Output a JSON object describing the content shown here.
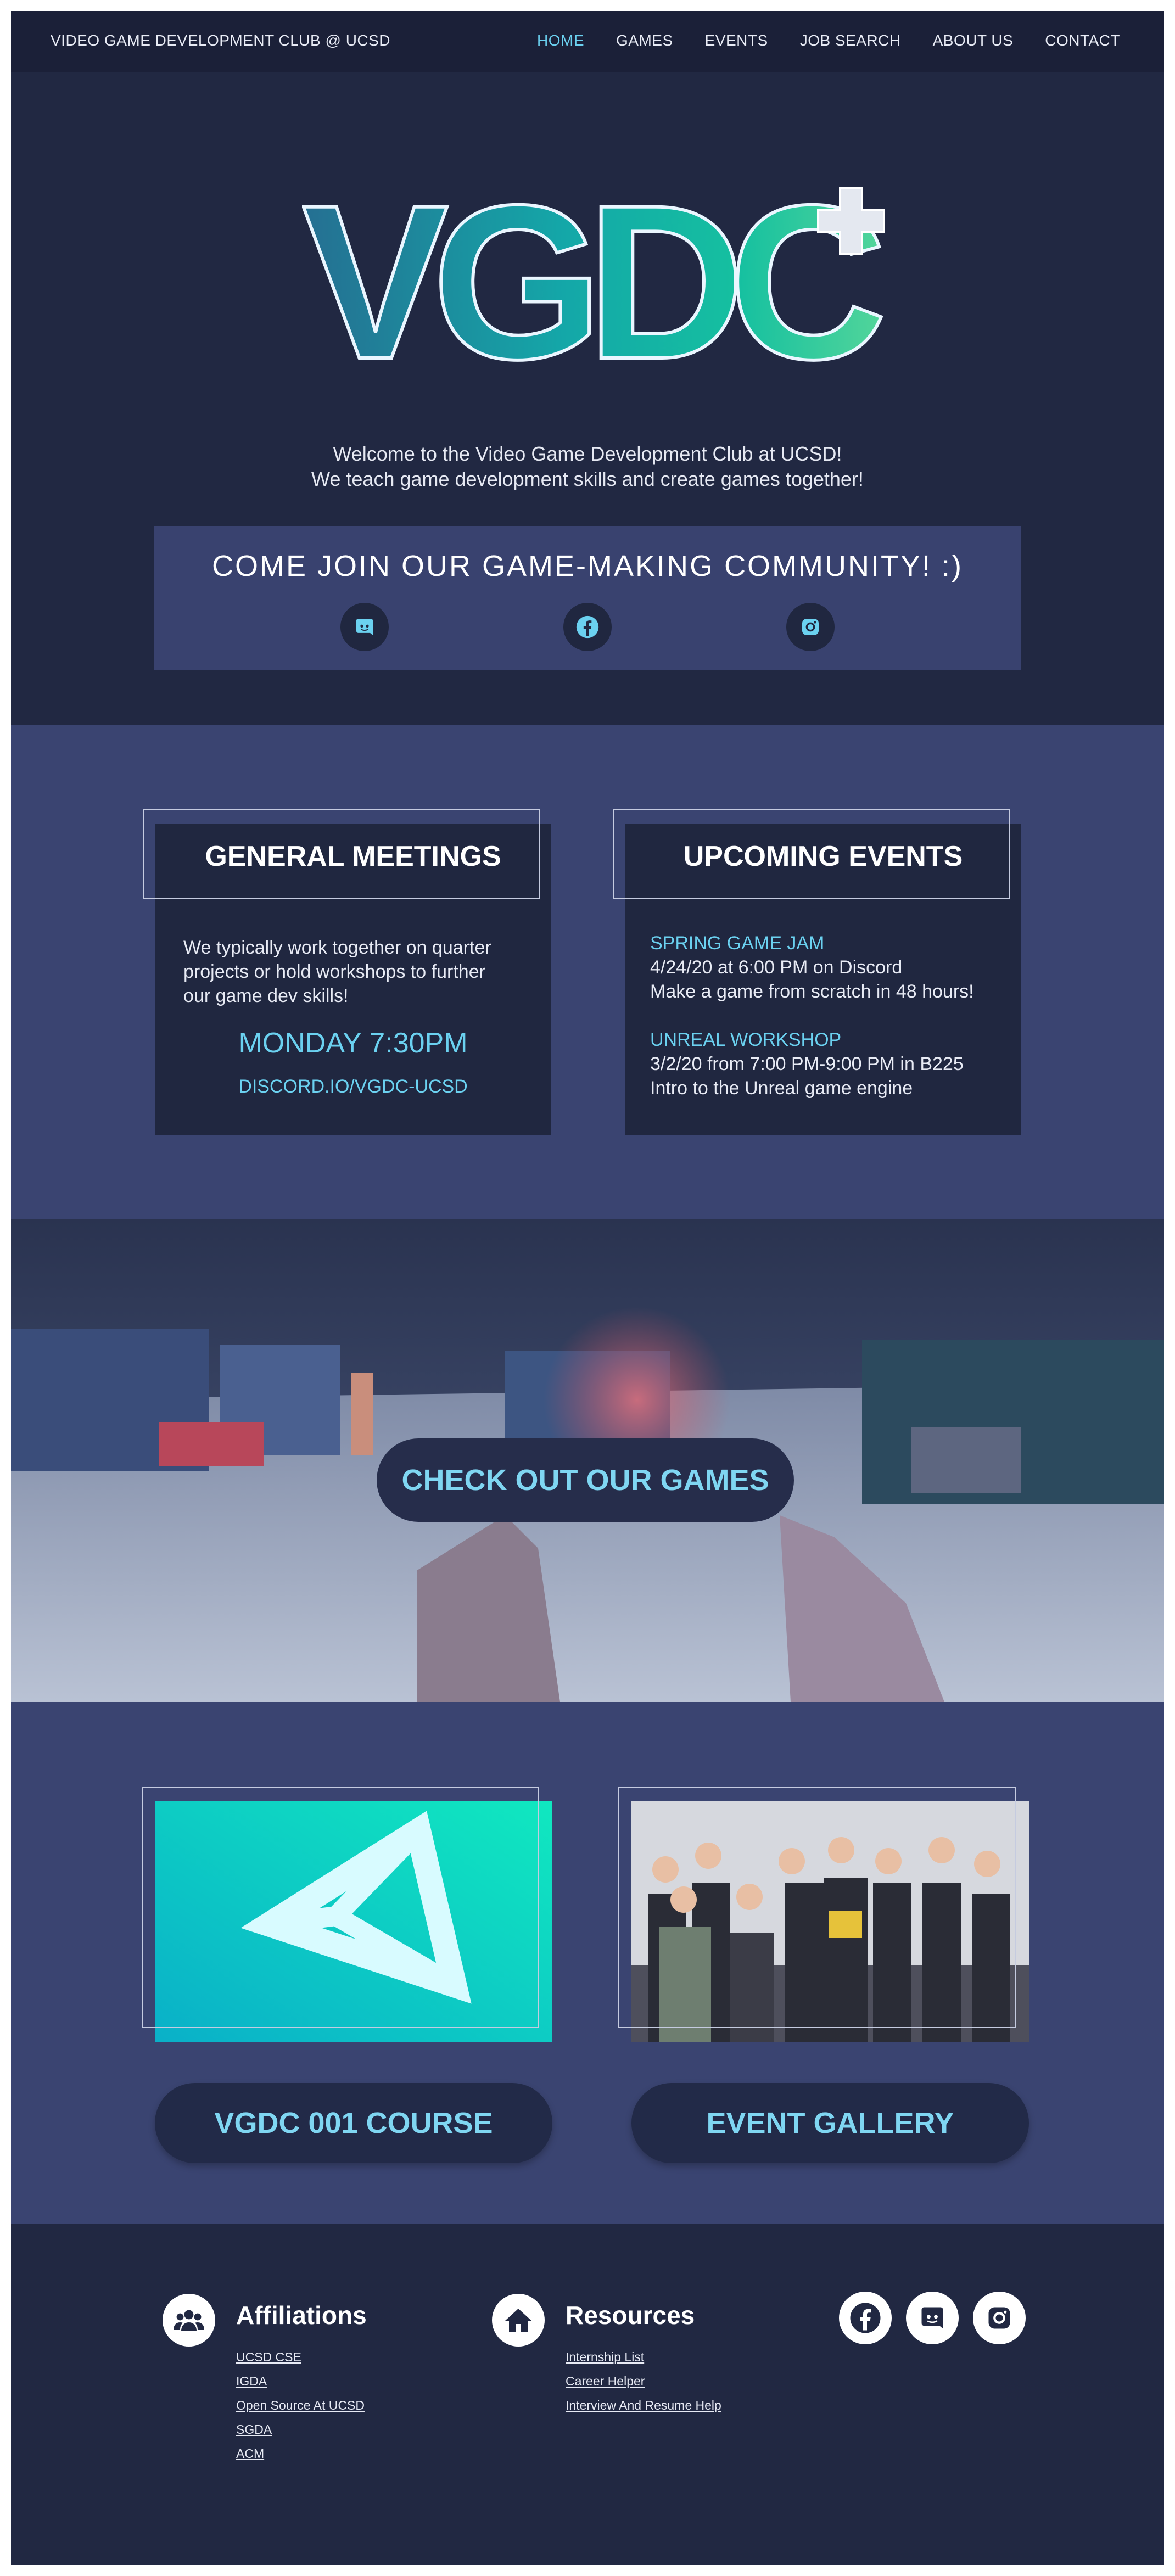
{
  "nav": {
    "brand": "VIDEO GAME DEVELOPMENT CLUB @ UCSD",
    "links": [
      "HOME",
      "GAMES",
      "EVENTS",
      "JOB SEARCH",
      "ABOUT US",
      "CONTACT"
    ],
    "active": "HOME"
  },
  "hero": {
    "logo_text": "VGDC",
    "welcome_line1": "Welcome to the Video Game Development Club at UCSD!",
    "welcome_line2": "We teach game development skills and create games together!",
    "join_title": "COME JOIN OUR GAME-MAKING COMMUNITY! :)",
    "socials": [
      "discord-icon",
      "facebook-icon",
      "instagram-icon"
    ]
  },
  "meetings": {
    "title": "GENERAL MEETINGS",
    "desc_line1": "We typically work together on quarter",
    "desc_line2": "projects or hold workshops to further",
    "desc_line3": "our game dev skills!",
    "time": "MONDAY 7:30PM",
    "link": "DISCORD.IO/VGDC-UCSD"
  },
  "events": {
    "title": "UPCOMING EVENTS",
    "items": [
      {
        "name": "SPRING GAME JAM",
        "when": "4/24/20 at 6:00 PM on Discord",
        "desc": "Make a game from scratch in 48 hours!"
      },
      {
        "name": "UNREAL WORKSHOP",
        "when": "3/2/20 from 7:00 PM-9:00 PM in B225",
        "desc": "Intro to the Unreal game engine"
      }
    ]
  },
  "games": {
    "button": "CHECK OUT OUR GAMES"
  },
  "course": {
    "button": "VGDC 001 COURSE"
  },
  "gallery": {
    "button": "EVENT GALLERY"
  },
  "footer": {
    "affiliations": {
      "heading": "Affiliations",
      "links": [
        "UCSD CSE",
        "IGDA",
        "Open Source At UCSD",
        "SGDA",
        "ACM"
      ]
    },
    "resources": {
      "heading": "Resources",
      "links": [
        "Internship List",
        "Career Helper",
        "Interview And Resume Help"
      ]
    },
    "socials": [
      "facebook-icon",
      "discord-icon",
      "instagram-icon"
    ]
  },
  "colors": {
    "background": "#212842",
    "band": "#3a4471",
    "accent": "#6bd1f0",
    "nav": "#1b2038"
  }
}
